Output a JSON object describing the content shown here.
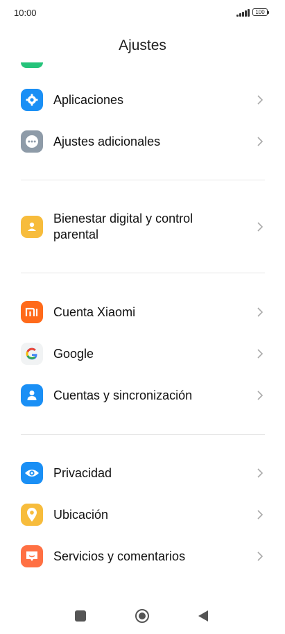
{
  "status_bar": {
    "time": "10:00",
    "battery": "100"
  },
  "header": {
    "title": "Ajustes"
  },
  "colors": {
    "green": "#25c37a",
    "blue": "#1a8ff5",
    "gray": "#8e9ba8",
    "yellow": "#f7bc3c",
    "orange": "#ff6a1a",
    "coral": "#ff7043"
  },
  "settings": {
    "items": [
      {
        "label": "Aplicaciones",
        "icon": "gear-icon"
      },
      {
        "label": "Ajustes adicionales",
        "icon": "more-dots-icon"
      },
      {
        "label": "Bienestar digital y control parental",
        "icon": "wellbeing-icon"
      },
      {
        "label": "Cuenta Xiaomi",
        "icon": "xiaomi-logo-icon"
      },
      {
        "label": "Google",
        "icon": "google-logo-icon"
      },
      {
        "label": "Cuentas y sincronización",
        "icon": "user-icon"
      },
      {
        "label": "Privacidad",
        "icon": "eye-icon"
      },
      {
        "label": "Ubicación",
        "icon": "location-pin-icon"
      },
      {
        "label": "Servicios y comentarios",
        "icon": "feedback-icon"
      }
    ]
  }
}
